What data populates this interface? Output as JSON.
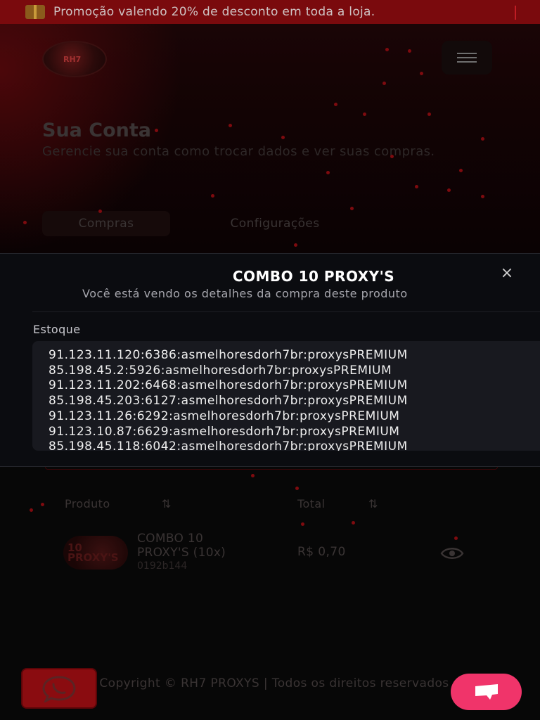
{
  "promo": {
    "text": "Promoção valendo 20% de desconto em toda a loja."
  },
  "header": {
    "logo_text": "RH7"
  },
  "account": {
    "title": "Sua Conta",
    "subtitle": "Gerencie sua conta como trocar dados e ver suas compras.",
    "tabs": [
      {
        "label": "Compras"
      },
      {
        "label": "Configurações"
      }
    ]
  },
  "modal": {
    "title": "COMBO 10 PROXY'S",
    "subtitle": "Você está vendo os detalhes da compra deste produto",
    "close_icon": "×",
    "stock_label": "Estoque",
    "stock_lines": [
      "91.123.11.120:6386:asmelhoresdorh7br:proxysPREMIUM",
      "85.198.45.2:5926:asmelhoresdorh7br:proxysPREMIUM",
      "91.123.11.202:6468:asmelhoresdorh7br:proxysPREMIUM",
      "85.198.45.203:6127:asmelhoresdorh7br:proxysPREMIUM",
      "91.123.11.26:6292:asmelhoresdorh7br:proxysPREMIUM",
      "91.123.10.87:6629:asmelhoresdorh7br:proxysPREMIUM",
      "85.198.45.118:6042:asmelhoresdorh7br:proxysPREMIUM"
    ]
  },
  "table": {
    "headers": {
      "product": "Produto",
      "total": "Total"
    },
    "sort_icon": "⇅",
    "rows": [
      {
        "thumb_text": "10\nPROXY'S",
        "name": "COMBO 10 PROXY'S (10x)",
        "id": "0192b144",
        "total": "R$ 0,70"
      }
    ]
  },
  "footer": {
    "text": "Copyright © RH7 PROXYS | Todos os direitos reservados"
  },
  "colors": {
    "accent": "#7a0a0d",
    "chat": "#f0346a",
    "modal_bg": "#0b0c10",
    "stock_bg": "#18191f"
  }
}
